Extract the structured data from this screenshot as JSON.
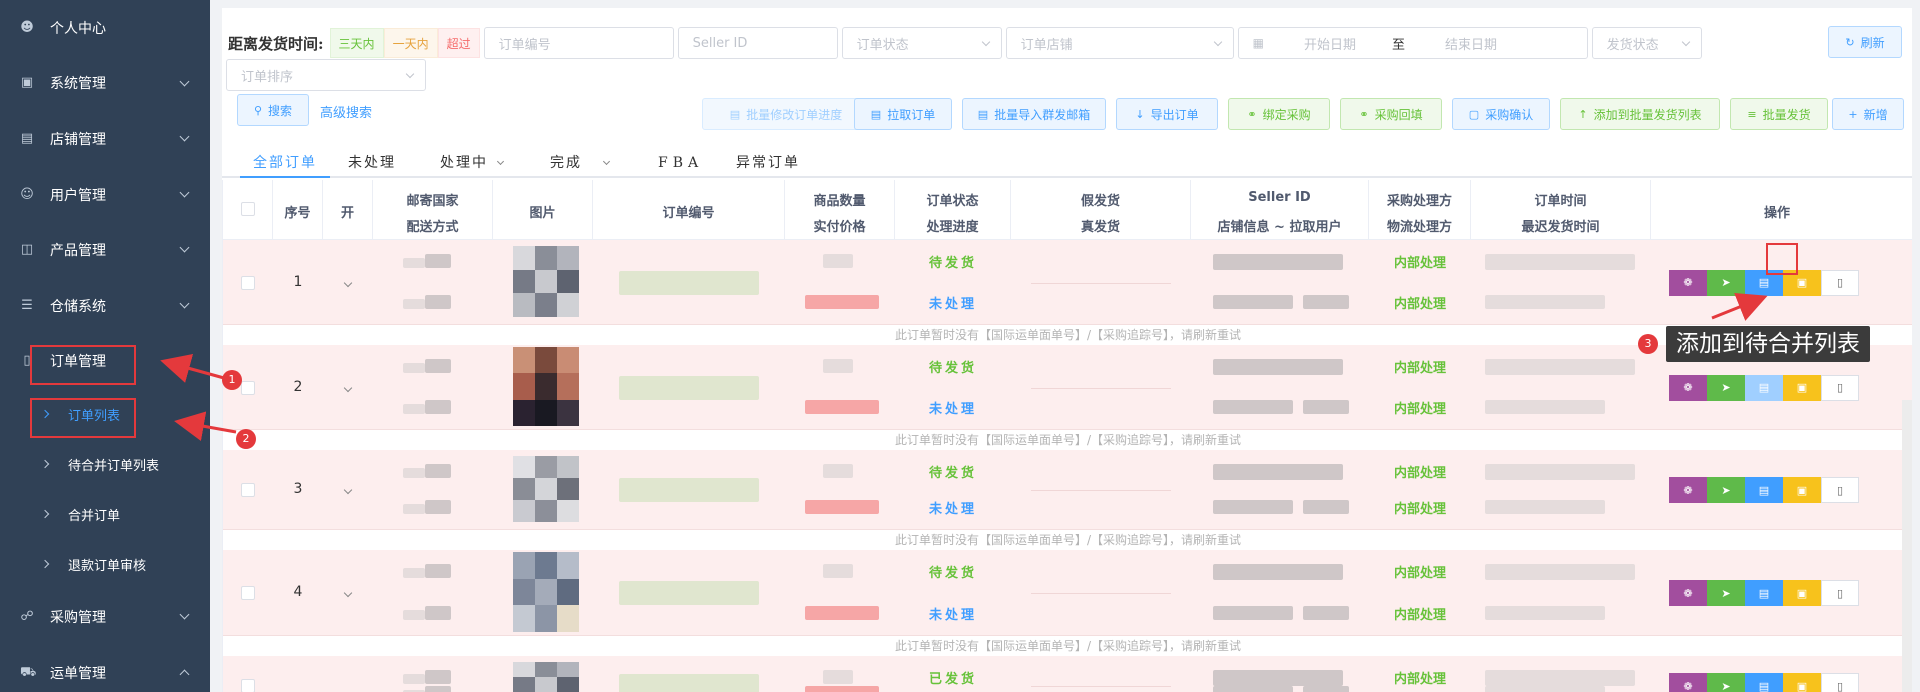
{
  "sidebar": {
    "items": [
      {
        "label": "个人中心",
        "icon": "user-icon",
        "chevron": "none"
      },
      {
        "label": "系统管理",
        "icon": "monitor-icon",
        "chevron": "down"
      },
      {
        "label": "店铺管理",
        "icon": "store-icon",
        "chevron": "down"
      },
      {
        "label": "用户管理",
        "icon": "users-icon",
        "chevron": "down"
      },
      {
        "label": "产品管理",
        "icon": "box-icon",
        "chevron": "down"
      },
      {
        "label": "仓储系统",
        "icon": "list-icon",
        "chevron": "down"
      },
      {
        "label": "订单管理",
        "icon": "document-icon",
        "chevron": "none"
      }
    ],
    "subitems": [
      {
        "label": "订单列表",
        "active": true
      },
      {
        "label": "待合并订单列表",
        "active": false
      },
      {
        "label": "合并订单",
        "active": false
      },
      {
        "label": "退款订单审核",
        "active": false
      }
    ],
    "bottom_items": [
      {
        "label": "采购管理",
        "icon": "cart-icon",
        "chevron": "down"
      },
      {
        "label": "运单管理",
        "icon": "truck-icon",
        "chevron": "up"
      }
    ]
  },
  "filters": {
    "ship_time_label": "距离发货时间:",
    "tag_three_days": "三天内",
    "tag_one_day": "一天内",
    "tag_overdue": "超过",
    "order_no_placeholder": "订单编号",
    "seller_id_placeholder": "Seller ID",
    "order_status_placeholder": "订单状态",
    "order_store_placeholder": "订单店铺",
    "start_date_placeholder": "开始日期",
    "date_separator": "至",
    "end_date_placeholder": "结束日期",
    "ship_status_placeholder": "发货状态",
    "refresh_label": "刷新",
    "sort_placeholder": "订单排序",
    "search_label": "搜索",
    "advanced_search_label": "高级搜索"
  },
  "toolbar": {
    "batch_modify_label": "批量修改订单进度",
    "pull_orders_label": "拉取订单",
    "batch_import_label": "批量导入群发邮箱",
    "export_label": "导出订单",
    "bind_purchase_label": "绑定采购",
    "purchase_backfill_label": "采购回填",
    "purchase_confirm_label": "采购确认",
    "add_batch_ship_label": "添加到批量发货列表",
    "batch_ship_label": "批量发货",
    "new_label": "新增"
  },
  "tabs": [
    {
      "label": "全部订单",
      "active": true,
      "dropdown": false
    },
    {
      "label": "未处理",
      "active": false,
      "dropdown": false
    },
    {
      "label": "处理中",
      "active": false,
      "dropdown": true
    },
    {
      "label": "完成",
      "active": false,
      "dropdown": true
    },
    {
      "label": "FBA",
      "active": false,
      "dropdown": false
    },
    {
      "label": "异常订单",
      "active": false,
      "dropdown": false
    }
  ],
  "table": {
    "headers": {
      "seq": "序号",
      "open": "开",
      "country": "邮寄国家",
      "shipping_method": "配送方式",
      "image": "图片",
      "order_no": "订单编号",
      "quantity": "商品数量",
      "paid_price": "实付价格",
      "order_status": "订单状态",
      "progress": "处理进度",
      "fake_ship": "假发货",
      "real_ship": "真发货",
      "seller_id": "Seller ID",
      "store_info": "店铺信息 ~ 拉取用户",
      "purchase_handler": "采购处理方",
      "logistics_handler": "物流处理方",
      "order_time": "订单时间",
      "latest_ship_time": "最迟发货时间",
      "actions": "操作"
    },
    "rows": [
      {
        "seq": "1",
        "status": "待发货",
        "progress": "未处理",
        "purchase": "内部处理",
        "logistics": "内部处理"
      },
      {
        "seq": "2",
        "status": "待发货",
        "progress": "未处理",
        "purchase": "内部处理",
        "logistics": "内部处理"
      },
      {
        "seq": "3",
        "status": "待发货",
        "progress": "未处理",
        "purchase": "内部处理",
        "logistics": "内部处理"
      },
      {
        "seq": "4",
        "status": "待发货",
        "progress": "未处理",
        "purchase": "内部处理",
        "logistics": "内部处理"
      },
      {
        "seq": "",
        "status": "已发货",
        "progress": "",
        "purchase": "内部处理",
        "logistics": ""
      }
    ],
    "row_note": "此订单暂时没有【国际运单面单号】/【采购追踪号】，请刷新重试"
  },
  "annotations": {
    "badge_1": "1",
    "badge_2": "2",
    "badge_3": "3",
    "tooltip": "添加到待合并列表",
    "color": "#e4393c"
  },
  "colors": {
    "sidebar_bg": "#304156",
    "accent": "#409eff",
    "row_bg": "#fdeeee",
    "status_green": "#67c23a"
  }
}
